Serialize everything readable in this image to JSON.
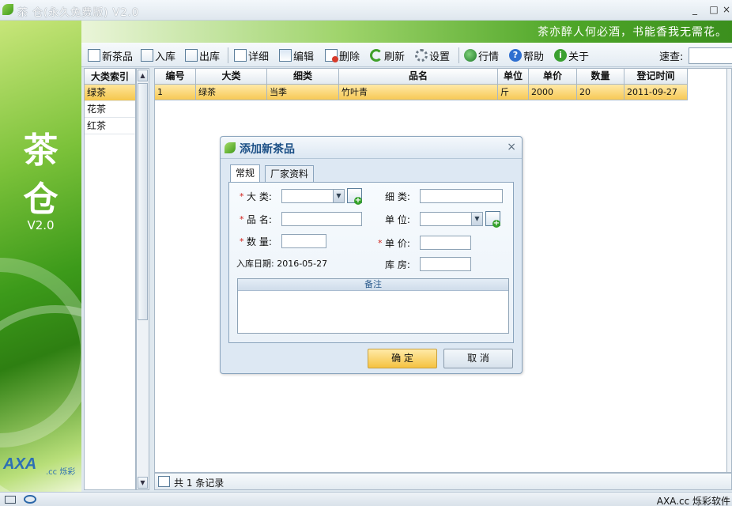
{
  "window": {
    "title": "茶 仓(永久免费版) V2.0",
    "min": "_",
    "max": "□",
    "close": "×"
  },
  "left": {
    "char1": "茶",
    "char2": "仓",
    "version": "V2.0",
    "brand": "AXA",
    "brand_suffix": ".cc 烁彩"
  },
  "banner": {
    "slogan": "茶亦醉人何必酒，书能香我无需花。"
  },
  "toolbar": {
    "new_item": "新茶品",
    "stock_in": "入库",
    "stock_out": "出库",
    "details": "详细",
    "edit": "编辑",
    "delete": "删除",
    "refresh": "刷新",
    "settings": "设置",
    "market": "行情",
    "help": "帮助",
    "about": "关于",
    "search_label": "速查:",
    "search_value": ""
  },
  "categories": {
    "header": "大类索引",
    "items": [
      "绿茶",
      "花茶",
      "红茶"
    ]
  },
  "table": {
    "headers": [
      "编号",
      "大类",
      "细类",
      "品名",
      "单位",
      "单价",
      "数量",
      "登记时间"
    ],
    "rows": [
      [
        "1",
        "绿茶",
        "当季",
        "竹叶青",
        "斤",
        "2000",
        "20",
        "2011-09-27"
      ]
    ]
  },
  "status": {
    "record_count": "共 1 条记录",
    "footer": "AXA.cc 烁彩软件"
  },
  "dialog": {
    "title": "添加新茶品",
    "close": "×",
    "tabs": [
      "常规",
      "厂家资料"
    ],
    "fields": {
      "category_label": "大  类:",
      "subcategory_label": "细  类:",
      "name_label": "品  名:",
      "unit_label": "单  位:",
      "quantity_label": "数  量:",
      "price_label": "单  价:",
      "date_label": "入库日期: 2016-05-27",
      "warehouse_label": "库  房:",
      "required_mark": "*"
    },
    "notes_header": "备注",
    "ok": "确 定",
    "cancel": "取 消"
  }
}
